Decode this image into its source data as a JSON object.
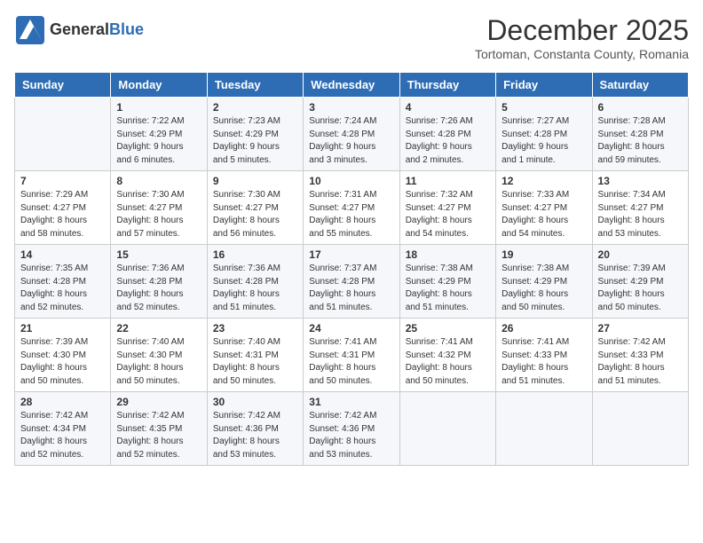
{
  "header": {
    "logo_line1": "General",
    "logo_line2": "Blue",
    "month_title": "December 2025",
    "location": "Tortoman, Constanta County, Romania"
  },
  "days_of_week": [
    "Sunday",
    "Monday",
    "Tuesday",
    "Wednesday",
    "Thursday",
    "Friday",
    "Saturday"
  ],
  "weeks": [
    [
      {
        "day": "",
        "info": ""
      },
      {
        "day": "1",
        "info": "Sunrise: 7:22 AM\nSunset: 4:29 PM\nDaylight: 9 hours\nand 6 minutes."
      },
      {
        "day": "2",
        "info": "Sunrise: 7:23 AM\nSunset: 4:29 PM\nDaylight: 9 hours\nand 5 minutes."
      },
      {
        "day": "3",
        "info": "Sunrise: 7:24 AM\nSunset: 4:28 PM\nDaylight: 9 hours\nand 3 minutes."
      },
      {
        "day": "4",
        "info": "Sunrise: 7:26 AM\nSunset: 4:28 PM\nDaylight: 9 hours\nand 2 minutes."
      },
      {
        "day": "5",
        "info": "Sunrise: 7:27 AM\nSunset: 4:28 PM\nDaylight: 9 hours\nand 1 minute."
      },
      {
        "day": "6",
        "info": "Sunrise: 7:28 AM\nSunset: 4:28 PM\nDaylight: 8 hours\nand 59 minutes."
      }
    ],
    [
      {
        "day": "7",
        "info": "Sunrise: 7:29 AM\nSunset: 4:27 PM\nDaylight: 8 hours\nand 58 minutes."
      },
      {
        "day": "8",
        "info": "Sunrise: 7:30 AM\nSunset: 4:27 PM\nDaylight: 8 hours\nand 57 minutes."
      },
      {
        "day": "9",
        "info": "Sunrise: 7:30 AM\nSunset: 4:27 PM\nDaylight: 8 hours\nand 56 minutes."
      },
      {
        "day": "10",
        "info": "Sunrise: 7:31 AM\nSunset: 4:27 PM\nDaylight: 8 hours\nand 55 minutes."
      },
      {
        "day": "11",
        "info": "Sunrise: 7:32 AM\nSunset: 4:27 PM\nDaylight: 8 hours\nand 54 minutes."
      },
      {
        "day": "12",
        "info": "Sunrise: 7:33 AM\nSunset: 4:27 PM\nDaylight: 8 hours\nand 54 minutes."
      },
      {
        "day": "13",
        "info": "Sunrise: 7:34 AM\nSunset: 4:27 PM\nDaylight: 8 hours\nand 53 minutes."
      }
    ],
    [
      {
        "day": "14",
        "info": "Sunrise: 7:35 AM\nSunset: 4:28 PM\nDaylight: 8 hours\nand 52 minutes."
      },
      {
        "day": "15",
        "info": "Sunrise: 7:36 AM\nSunset: 4:28 PM\nDaylight: 8 hours\nand 52 minutes."
      },
      {
        "day": "16",
        "info": "Sunrise: 7:36 AM\nSunset: 4:28 PM\nDaylight: 8 hours\nand 51 minutes."
      },
      {
        "day": "17",
        "info": "Sunrise: 7:37 AM\nSunset: 4:28 PM\nDaylight: 8 hours\nand 51 minutes."
      },
      {
        "day": "18",
        "info": "Sunrise: 7:38 AM\nSunset: 4:29 PM\nDaylight: 8 hours\nand 51 minutes."
      },
      {
        "day": "19",
        "info": "Sunrise: 7:38 AM\nSunset: 4:29 PM\nDaylight: 8 hours\nand 50 minutes."
      },
      {
        "day": "20",
        "info": "Sunrise: 7:39 AM\nSunset: 4:29 PM\nDaylight: 8 hours\nand 50 minutes."
      }
    ],
    [
      {
        "day": "21",
        "info": "Sunrise: 7:39 AM\nSunset: 4:30 PM\nDaylight: 8 hours\nand 50 minutes."
      },
      {
        "day": "22",
        "info": "Sunrise: 7:40 AM\nSunset: 4:30 PM\nDaylight: 8 hours\nand 50 minutes."
      },
      {
        "day": "23",
        "info": "Sunrise: 7:40 AM\nSunset: 4:31 PM\nDaylight: 8 hours\nand 50 minutes."
      },
      {
        "day": "24",
        "info": "Sunrise: 7:41 AM\nSunset: 4:31 PM\nDaylight: 8 hours\nand 50 minutes."
      },
      {
        "day": "25",
        "info": "Sunrise: 7:41 AM\nSunset: 4:32 PM\nDaylight: 8 hours\nand 50 minutes."
      },
      {
        "day": "26",
        "info": "Sunrise: 7:41 AM\nSunset: 4:33 PM\nDaylight: 8 hours\nand 51 minutes."
      },
      {
        "day": "27",
        "info": "Sunrise: 7:42 AM\nSunset: 4:33 PM\nDaylight: 8 hours\nand 51 minutes."
      }
    ],
    [
      {
        "day": "28",
        "info": "Sunrise: 7:42 AM\nSunset: 4:34 PM\nDaylight: 8 hours\nand 52 minutes."
      },
      {
        "day": "29",
        "info": "Sunrise: 7:42 AM\nSunset: 4:35 PM\nDaylight: 8 hours\nand 52 minutes."
      },
      {
        "day": "30",
        "info": "Sunrise: 7:42 AM\nSunset: 4:36 PM\nDaylight: 8 hours\nand 53 minutes."
      },
      {
        "day": "31",
        "info": "Sunrise: 7:42 AM\nSunset: 4:36 PM\nDaylight: 8 hours\nand 53 minutes."
      },
      {
        "day": "",
        "info": ""
      },
      {
        "day": "",
        "info": ""
      },
      {
        "day": "",
        "info": ""
      }
    ]
  ]
}
